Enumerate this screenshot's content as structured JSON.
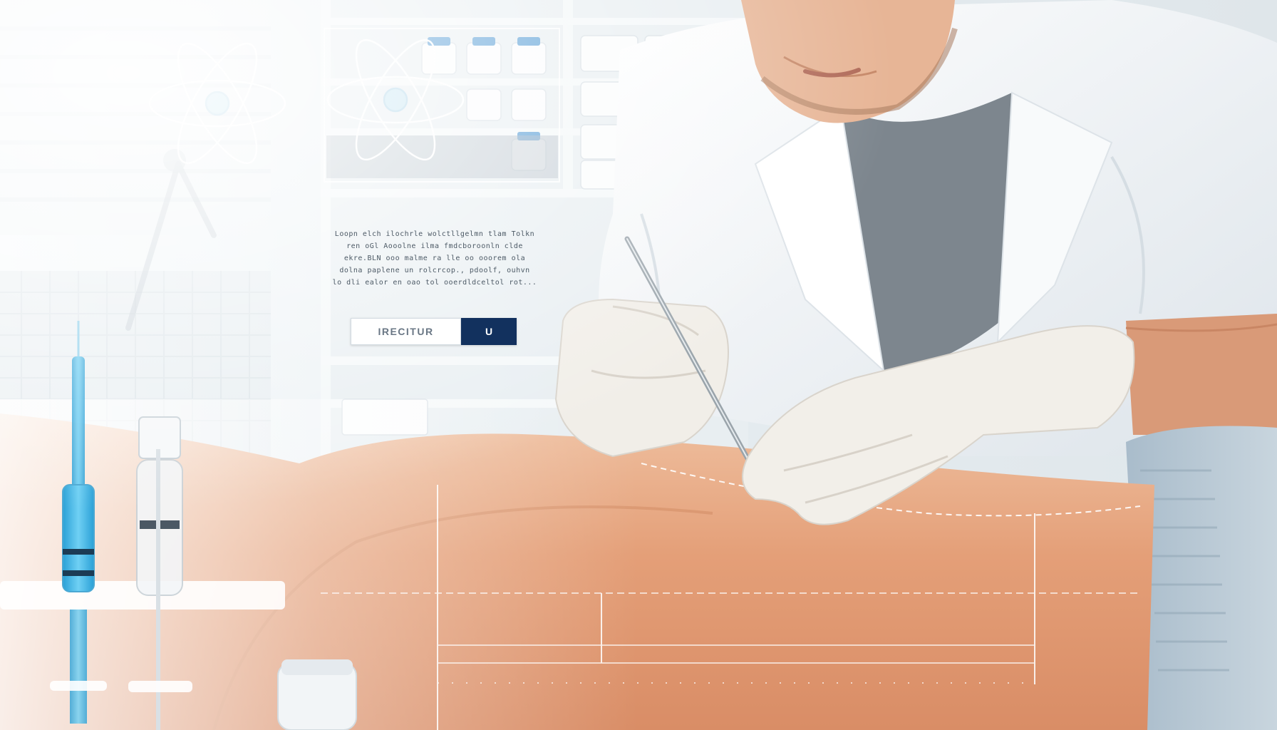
{
  "overlay": {
    "lines": [
      "Loopn elch  ilochrle  wolctllgelmn  tlam  Tolkn",
      "ren  oGl  Aooolne  ilma  fmdcboroonln  clde",
      "ekre.BLN  ooo  malme  ra  lle  oo  ooorem  ola",
      "dolna  paplene  un  rolcrcop.,  pdoolf,  ouhvn",
      "lo  dli  ealor  en  oao  tol  ooerdldceltol  rot..."
    ]
  },
  "cta": {
    "left_label": "IRECITUR",
    "right_label": "U"
  },
  "icons": {
    "atom_left": "atom-icon",
    "atom_right": "atom-icon"
  },
  "colors": {
    "cta_dark": "#12315e",
    "syringe_liquid": "#3fb7e6",
    "lab_coat": "#f4f6f8",
    "skin": "#e7a27a",
    "glove": "#f2efe9",
    "towel": "#b8c8d4"
  }
}
